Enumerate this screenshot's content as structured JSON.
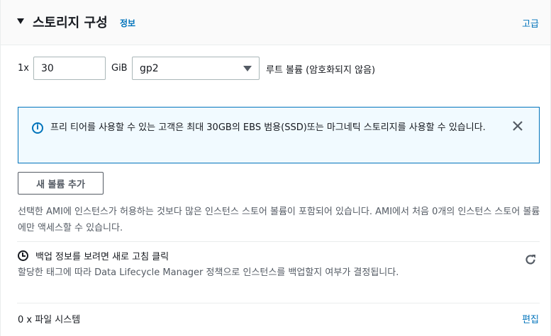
{
  "header": {
    "title": "스토리지 구성",
    "info_link": "정보",
    "advanced_link": "고급"
  },
  "volume": {
    "multiplier": "1x",
    "size_value": "30",
    "unit": "GiB",
    "type_selected": "gp2",
    "root_label": "루트 볼륨  (암호화되지 않음)"
  },
  "alert": {
    "text": "프리 티어를 사용할 수 있는 고객은 최대 30GB의 EBS 범용(SSD)또는 마그네틱 스토리지를 사용할 수 있습니다.",
    "close_icon": "close-icon",
    "info_icon": "info-icon"
  },
  "add_volume_button": "새 볼륨 추가",
  "description": "선택한 AMI에 인스턴스가 허용하는 것보다 많은 인스턴스 스토어 볼륨이 포함되어 있습니다. AMI에서 처음 0개의 인스턴스 스토어 볼륨에만 액세스할 수 있습니다.",
  "backup": {
    "title": "백업 정보를 보려면 새로 고침 클릭",
    "description": "할당한 태그에 따라 Data Lifecycle Manager 정책으로 인스턴스를 백업할지 여부가 결정됩니다.",
    "refresh_icon": "refresh-icon",
    "clock_icon": "clock-icon"
  },
  "file_systems": {
    "label": "0 x 파일 시스템",
    "edit_link": "편집"
  },
  "colors": {
    "link": "#0073bb",
    "alert_bg": "#f1faff",
    "text": "#16191f",
    "secondary_text": "#545b64"
  }
}
